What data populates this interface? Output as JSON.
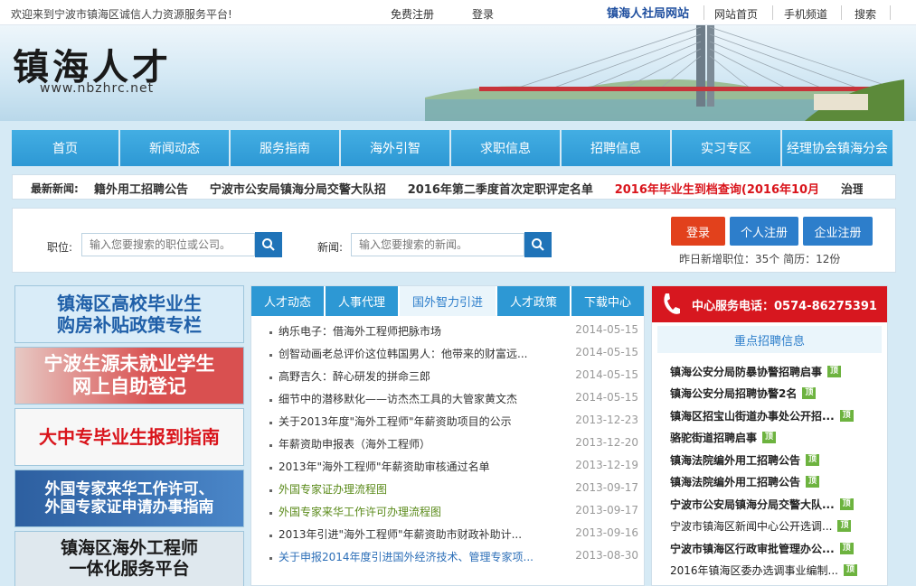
{
  "topbar": {
    "welcome": "欢迎来到宁波市镇海区诚信人力资源服务平台!",
    "register": "免费注册",
    "login": "登录",
    "bureau": "镇海人社局网站",
    "home": "网站首页",
    "mobile": "手机频道",
    "search": "搜索"
  },
  "banner": {
    "logo": "镇海人才",
    "url": "www.nbzhrc.net"
  },
  "nav": {
    "items": [
      "首页",
      "新闻动态",
      "服务指南",
      "海外引智",
      "求职信息",
      "招聘信息",
      "实习专区",
      "经理协会镇海分会"
    ]
  },
  "ticker": {
    "label": "最新新闻:",
    "items": [
      {
        "text": "籍外用工招聘公告",
        "color": "#333333"
      },
      {
        "text": "宁波市公安局镇海分局交警大队招",
        "color": "#333333"
      },
      {
        "text": "2016年第二季度首次定职评定名单",
        "color": "#333333"
      },
      {
        "text": "2016年毕业生到档查询(2016年10月",
        "color": "#d9141b"
      },
      {
        "text": "治理招聘网",
        "color": "#333333"
      }
    ]
  },
  "search": {
    "job_label": "职位:",
    "job_placeholder": "输入您要搜索的职位或公司。",
    "news_label": "新闻:",
    "news_placeholder": "输入您要搜索的新闻。",
    "login_btn": "登录",
    "personal_btn": "个人注册",
    "company_btn": "企业注册",
    "stats": "昨日新增职位：35个 简历：12份"
  },
  "promos": [
    {
      "text": "镇海区高校毕业生\n购房补贴政策专栏",
      "color": "#1f5fa8",
      "bg": "#d9ecf8"
    },
    {
      "text": "宁波生源未就业学生\n网上自助登记",
      "color": "#ffffff",
      "bg": "#d95050"
    },
    {
      "text": "大中专毕业生报到指南",
      "color": "#d9141b",
      "bg": "#f7f7f7"
    },
    {
      "text": "外国专家来华工作许可、\n外国专家证申请办事指南",
      "color": "#ffffff",
      "bg": "#3a6fb5"
    },
    {
      "text": "镇海区海外工程师\n一体化服务平台",
      "color": "#1a1a1a",
      "bg": "#dfe8ee"
    }
  ],
  "tabs": {
    "items": [
      "人才动态",
      "人事代理",
      "国外智力引进",
      "人才政策",
      "下载中心"
    ],
    "active": 2
  },
  "middle_list": [
    {
      "title": "纳乐电子：借海外工程师把脉市场",
      "date": "2014-05-15",
      "style": ""
    },
    {
      "title": "创智动画老总评价这位韩国男人：他带来的财富远...",
      "date": "2014-05-15",
      "style": ""
    },
    {
      "title": "高野吉久：醉心研发的拼命三郎",
      "date": "2014-05-15",
      "style": ""
    },
    {
      "title": "细节中的潜移默化——访杰杰工具的大管家黄文杰",
      "date": "2014-05-15",
      "style": ""
    },
    {
      "title": "关于2013年度\"海外工程师\"年薪资助项目的公示",
      "date": "2013-12-23",
      "style": ""
    },
    {
      "title": "年薪资助申报表（海外工程师）",
      "date": "2013-12-20",
      "style": ""
    },
    {
      "title": "2013年\"海外工程师\"年薪资助审核通过名单",
      "date": "2013-12-19",
      "style": ""
    },
    {
      "title": "外国专家证办理流程图",
      "date": "2013-09-17",
      "style": "green"
    },
    {
      "title": "外国专家来华工作许可办理流程图",
      "date": "2013-09-17",
      "style": "green"
    },
    {
      "title": "2013年引进\"海外工程师\"年薪资助市财政补助计...",
      "date": "2013-09-16",
      "style": ""
    },
    {
      "title": "关于申报2014年度引进国外经济技术、管理专家项...",
      "date": "2013-08-30",
      "style": "blue"
    }
  ],
  "right": {
    "hotline": "中心服务电话：0574-86275391",
    "heading": "重点招聘信息",
    "top_badge": "顶",
    "items": [
      {
        "text": "镇海公安分局防暴协警招聘启事",
        "bold": true
      },
      {
        "text": "镇海公安分局招聘协警2名",
        "bold": true
      },
      {
        "text": "镇海区招宝山街道办事处公开招...",
        "bold": true
      },
      {
        "text": "骆驼街道招聘启事",
        "bold": true
      },
      {
        "text": "镇海法院编外用工招聘公告",
        "bold": true
      },
      {
        "text": "镇海法院编外用工招聘公告",
        "bold": true
      },
      {
        "text": "宁波市公安局镇海分局交警大队...",
        "bold": true
      },
      {
        "text": "宁波市镇海区新闻中心公开选调...",
        "bold": false
      },
      {
        "text": "宁波市镇海区行政审批管理办公...",
        "bold": true
      },
      {
        "text": "2016年镇海区委办选调事业编制...",
        "bold": false
      }
    ]
  }
}
